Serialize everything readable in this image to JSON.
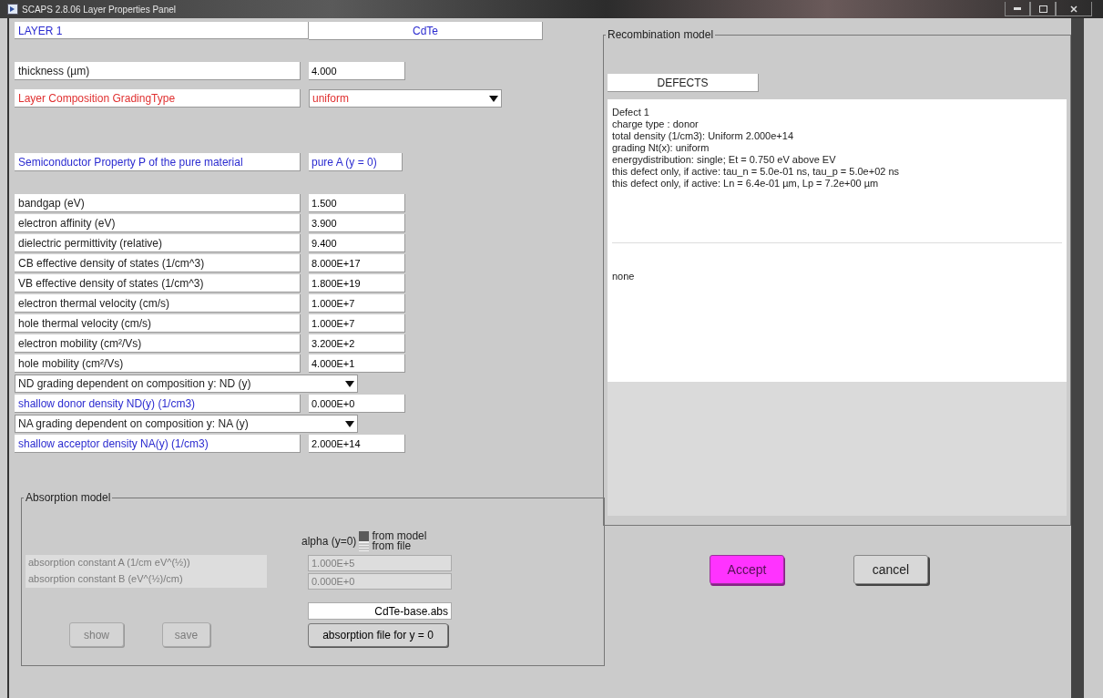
{
  "window": {
    "title": "SCAPS 2.8.06 Layer Properties Panel"
  },
  "layer": {
    "label": "LAYER 1",
    "name": "CdTe"
  },
  "thickness": {
    "label": "thickness (µm)",
    "value": "4.000"
  },
  "grading_type": {
    "label": "Layer Composition GradingType",
    "value": "uniform"
  },
  "property_header": {
    "label": "Semiconductor Property P of the pure material",
    "value": "pure A (y = 0)"
  },
  "properties": [
    {
      "label": "bandgap (eV)",
      "value": "1.500"
    },
    {
      "label": "electron affinity (eV)",
      "value": "3.900"
    },
    {
      "label": "dielectric permittivity (relative)",
      "value": "9.400"
    },
    {
      "label": "CB effective density of states (1/cm^3)",
      "value": "8.000E+17"
    },
    {
      "label": "VB effective density of states (1/cm^3)",
      "value": "1.800E+19"
    },
    {
      "label": "electron thermal velocity (cm/s)",
      "value": "1.000E+7"
    },
    {
      "label": "hole thermal velocity (cm/s)",
      "value": "1.000E+7"
    },
    {
      "label": "electron mobility (cm²/Vs)",
      "value": "3.200E+2"
    },
    {
      "label": "hole mobility (cm²/Vs)",
      "value": "4.000E+1"
    }
  ],
  "doping": [
    {
      "kind": "dropdown",
      "value": "ND grading dependent on composition y: ND (y)"
    },
    {
      "kind": "field",
      "label": "shallow donor density ND(y) (1/cm3)",
      "value": "0.000E+0"
    },
    {
      "kind": "dropdown",
      "value": "NA grading dependent on composition y: NA (y)"
    },
    {
      "kind": "field",
      "label": "shallow acceptor density NA(y) (1/cm3)",
      "value": "2.000E+14"
    }
  ],
  "absorption": {
    "title": "Absorption model",
    "alpha_label": "alpha (y=0)",
    "sources": [
      {
        "label": "from model",
        "selected": true
      },
      {
        "label": "from file",
        "selected": false
      }
    ],
    "constants": [
      {
        "label": "absorption constant A (1/cm eV^(½))",
        "value": "1.000E+5",
        "disabled": true
      },
      {
        "label": "absorption constant B (eV^(½)/cm)",
        "value": "0.000E+0",
        "disabled": true
      }
    ],
    "file": "CdTe-base.abs",
    "file_button": "absorption file for y = 0",
    "buttons": [
      {
        "label": "show",
        "disabled": true
      },
      {
        "label": "save",
        "disabled": true
      }
    ]
  },
  "recombination": {
    "title": "Recombination model",
    "tab": "DEFECTS",
    "defect_lines": [
      "Defect 1",
      "charge type : donor",
      "total density (1/cm3): Uniform  2.000e+14",
      "grading Nt(x): uniform",
      "energydistribution: single; Et = 0.750 eV above EV",
      "this defect only, if active: tau_n =  5.0e-01 ns, tau_p =  5.0e+02 ns",
      "this defect only, if active: Ln =  6.4e-01 µm, Lp =  7.2e+00 µm"
    ],
    "second_list": "none"
  },
  "buttons": [
    {
      "label": "Accept",
      "kind": "primary"
    },
    {
      "label": "cancel",
      "kind": "normal"
    }
  ]
}
